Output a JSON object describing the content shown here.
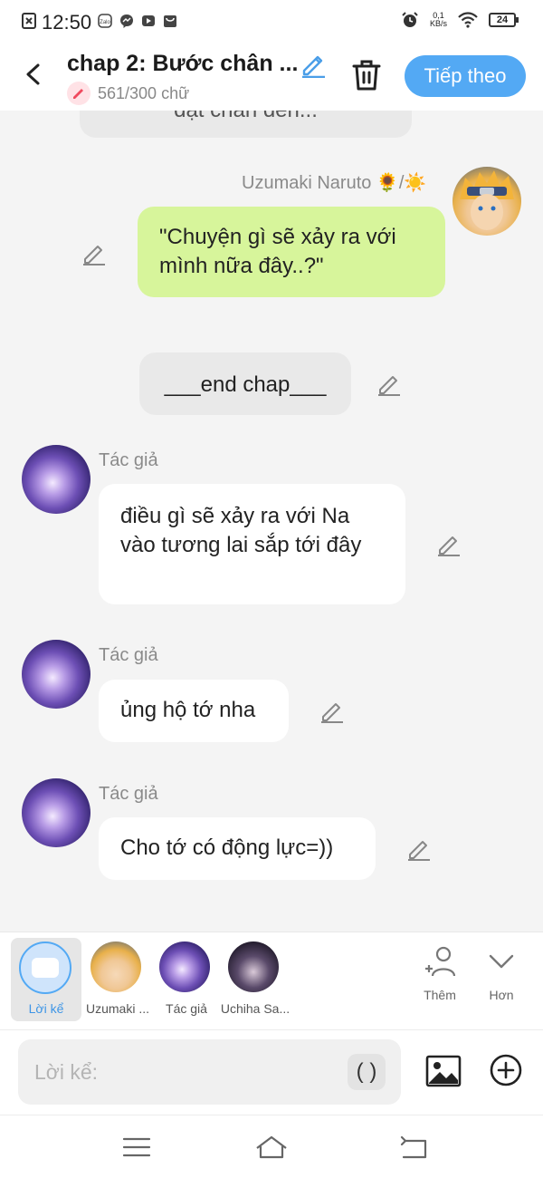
{
  "status_bar": {
    "time": "12:50",
    "net_speed_value": "0,1",
    "net_speed_unit": "KB/s",
    "battery": "24"
  },
  "header": {
    "title": "chap 2: Bước chân ...",
    "word_count": "561/300 chữ",
    "next_button": "Tiếp theo"
  },
  "messages": [
    {
      "type": "narration-partial",
      "text": "đặt chân đến..."
    },
    {
      "type": "right",
      "sender": "Uzumaki Naruto 🌻/☀️",
      "text": "\"Chuyện gì sẽ xảy ra với mình nữa đây..?\""
    },
    {
      "type": "narration",
      "text": "___end chap___"
    },
    {
      "type": "left",
      "sender": "Tác giả",
      "text": "điều gì sẽ xảy ra với Na vào tương lai sắp tới đây"
    },
    {
      "type": "left",
      "sender": "Tác giả",
      "text": "ủng hộ tớ nha"
    },
    {
      "type": "left",
      "sender": "Tác giả",
      "text": "Cho tớ có động lực=))"
    }
  ],
  "characters": [
    {
      "label": "Lời kể",
      "selected": true
    },
    {
      "label": "Uzumaki ..."
    },
    {
      "label": "Tác giả"
    },
    {
      "label": "Uchiha Sa..."
    }
  ],
  "tools": {
    "add_label": "Thêm",
    "more_label": "Hơn"
  },
  "input": {
    "placeholder": "Lời kể:",
    "paren_button": "( )"
  },
  "colors": {
    "accent": "#53a9f4",
    "right_bubble": "#d7f59b",
    "left_bubble": "#ffffff",
    "narration_bubble": "#e9e9e9"
  },
  "icons": [
    "back-arrow-icon",
    "pencil-icon",
    "trash-icon",
    "add-person-icon",
    "chevron-down-icon",
    "image-icon",
    "plus-circle-icon",
    "menu-icon",
    "home-icon",
    "back-icon"
  ]
}
